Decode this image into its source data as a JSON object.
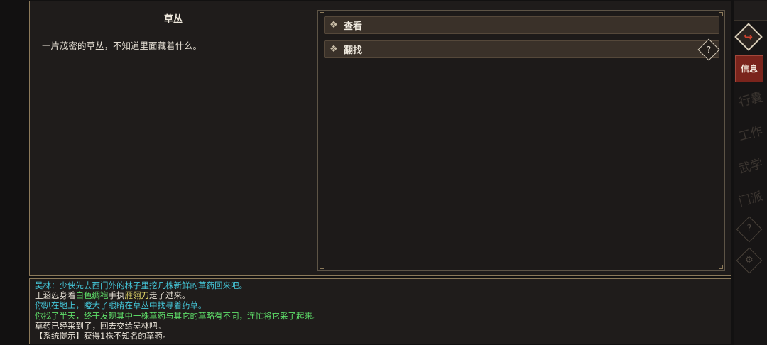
{
  "location": {
    "title": "草丛",
    "description": "一片茂密的草丛，不知道里面藏着什么。"
  },
  "actions": [
    {
      "label": "查看"
    },
    {
      "label": "翻找",
      "help": "?"
    }
  ],
  "log": [
    {
      "parts": [
        {
          "text": "吴林：少侠先去西门外的林子里挖几株新鲜的草药回来吧。",
          "color": "#45c7d9"
        }
      ]
    },
    {
      "parts": [
        {
          "text": "王涵忍身着",
          "color": "#e9e3d8"
        },
        {
          "text": "白色绸袍",
          "color": "#5fe06a"
        },
        {
          "text": "手执",
          "color": "#e9e3d8"
        },
        {
          "text": "雁翎刀",
          "color": "#e7dc6b"
        },
        {
          "text": "走了过来。",
          "color": "#e9e3d8"
        }
      ]
    },
    {
      "parts": [
        {
          "text": "你趴在地上，瞪大了眼睛在草丛中找寻着药草。",
          "color": "#45c7d9"
        }
      ]
    },
    {
      "parts": [
        {
          "text": "你找了半天，终于发现其中一株草药与其它的草略有不同，连忙将它采了起来。",
          "color": "#5fe06a"
        }
      ]
    },
    {
      "parts": [
        {
          "text": "草药已经采到了，回去交给吴林吧。",
          "color": "#e9e3d8"
        }
      ]
    },
    {
      "parts": [
        {
          "text": "【系统提示】获得1株不知名的草药。",
          "color": "#e9e3d8"
        }
      ]
    }
  ],
  "sidebar": {
    "back_icon": "↪",
    "info_label": "信息",
    "tabs": [
      "行囊",
      "工作",
      "武学",
      "门派"
    ],
    "help_icon": "?",
    "settings_icon": "⚙"
  }
}
